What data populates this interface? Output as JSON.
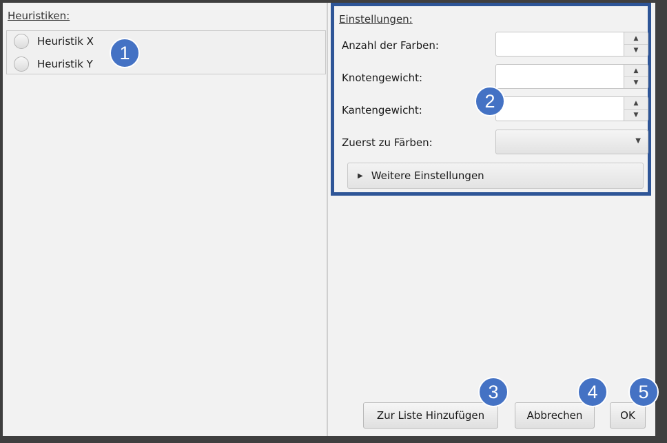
{
  "heuristics": {
    "title": "Heuristiken:",
    "items": [
      {
        "label": "Heuristik X"
      },
      {
        "label": "Heuristik Y"
      }
    ]
  },
  "settings": {
    "title": "Einstellungen:",
    "fields": [
      {
        "label": "Anzahl der Farben:",
        "value": ""
      },
      {
        "label": "Knotengewicht:",
        "value": ""
      },
      {
        "label": "Kantengewicht:",
        "value": ""
      }
    ],
    "first_color": {
      "label": "Zuerst zu Färben:",
      "value": ""
    },
    "more_settings": "Weitere Einstellungen"
  },
  "buttons": {
    "add_to_list": "Zur Liste Hinzufügen",
    "cancel": "Abbrechen",
    "ok": "OK"
  },
  "callouts": [
    "1",
    "2",
    "3",
    "4",
    "5"
  ],
  "colors": {
    "callout": "#4472c4",
    "highlight_border": "#2e5597"
  }
}
